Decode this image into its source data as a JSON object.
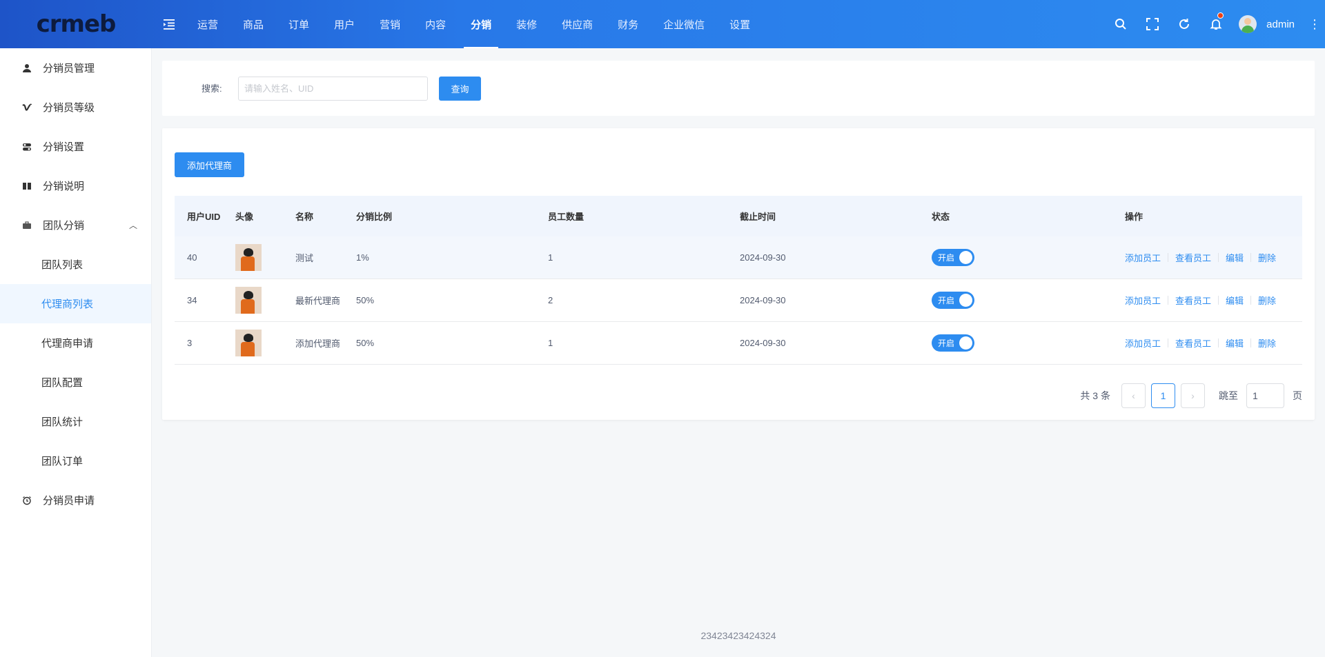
{
  "logo": {
    "text": "crmeb"
  },
  "topnav": {
    "items": [
      "运营",
      "商品",
      "订单",
      "用户",
      "营销",
      "内容",
      "分销",
      "装修",
      "供应商",
      "财务",
      "企业微信",
      "设置"
    ],
    "active_index": 6
  },
  "header": {
    "username": "admin"
  },
  "sidebar": {
    "items": [
      {
        "label": "分销员管理",
        "icon": "user-icon"
      },
      {
        "label": "分销员等级",
        "icon": "vimeo-v-icon"
      },
      {
        "label": "分销设置",
        "icon": "toggle-icon"
      },
      {
        "label": "分销说明",
        "icon": "book-icon"
      },
      {
        "label": "团队分销",
        "icon": "briefcase-icon"
      },
      {
        "label": "分销员申请",
        "icon": "alarm-clock-icon"
      }
    ],
    "sub_items": [
      "团队列表",
      "代理商列表",
      "代理商申请",
      "团队配置",
      "团队统计",
      "团队订单"
    ],
    "active_sub": "代理商列表"
  },
  "search": {
    "label": "搜索:",
    "placeholder": "请输入姓名、UID",
    "value": "",
    "button": "查询"
  },
  "table": {
    "add_button": "添加代理商",
    "columns": [
      "用户UID",
      "头像",
      "名称",
      "分销比例",
      "员工数量",
      "截止时间",
      "状态",
      "操作"
    ],
    "rows": [
      {
        "uid": "40",
        "name": "测试",
        "ratio": "1%",
        "staff": "1",
        "deadline": "2024-09-30",
        "status": "开启"
      },
      {
        "uid": "34",
        "name": "最新代理商",
        "ratio": "50%",
        "staff": "2",
        "deadline": "2024-09-30",
        "status": "开启"
      },
      {
        "uid": "3",
        "name": "添加代理商",
        "ratio": "50%",
        "staff": "1",
        "deadline": "2024-09-30",
        "status": "开启"
      }
    ],
    "actions": [
      "添加员工",
      "查看员工",
      "编辑",
      "删除"
    ]
  },
  "pagination": {
    "total": "共 3 条",
    "current_page": "1",
    "jump_label": "跳至",
    "jump_value": "1",
    "page_suffix": "页"
  },
  "footer": {
    "text": "23423423424324"
  },
  "colors": {
    "primary": "#2d8cf0",
    "header_start": "#1e54c8",
    "header_end": "#2d8cf0"
  }
}
